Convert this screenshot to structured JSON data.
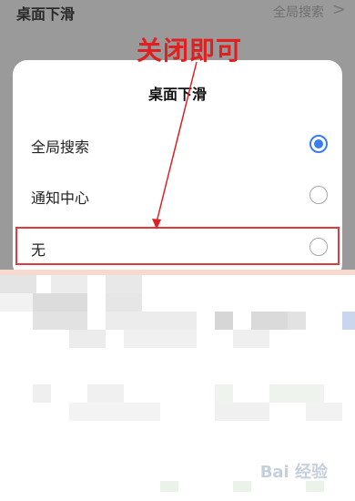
{
  "settings_row": {
    "title": "桌面下滑",
    "value": "全局搜索",
    "chevron": ">"
  },
  "dialog": {
    "title": "桌面下滑",
    "options": [
      {
        "label": "全局搜索",
        "selected": true
      },
      {
        "label": "通知中心",
        "selected": false
      },
      {
        "label": "无",
        "selected": false
      }
    ]
  },
  "annotation": {
    "text": "关闭即可",
    "color": "#e02020"
  },
  "watermark": {
    "text": "Bai 经验"
  },
  "colors": {
    "accent": "#3a7df0",
    "dim_overlay": "#9a9a9a"
  }
}
